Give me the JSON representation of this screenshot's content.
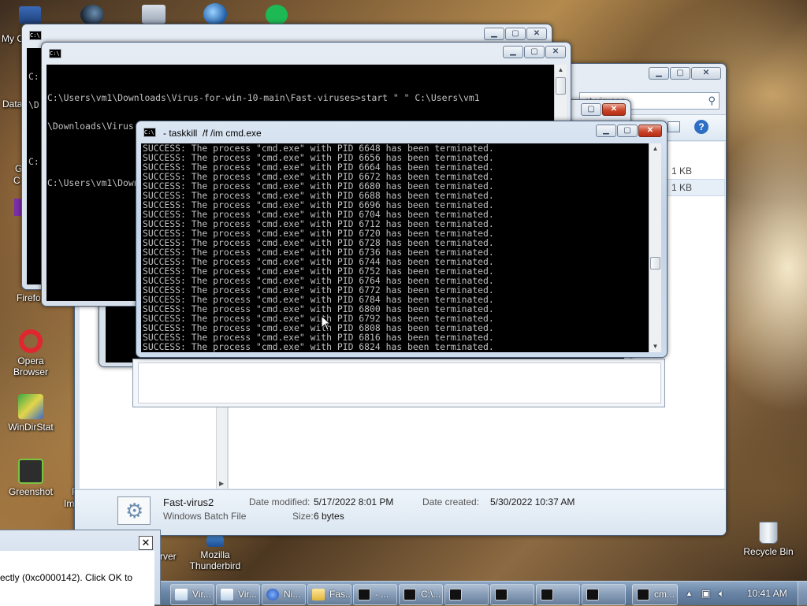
{
  "desktop": {
    "icons": [
      {
        "label": "Opera\nBrowser",
        "icon": "opera-icon"
      },
      {
        "label": "WinDirStat",
        "icon": "windirstat-icon"
      },
      {
        "label": "Greenshot",
        "icon": "greenshot-icon"
      },
      {
        "label": "Mozilla\nThunderbird",
        "icon": "thunderbird-icon"
      },
      {
        "label": "Recycle Bin",
        "icon": "recycle-bin-icon"
      }
    ],
    "partial_labels": [
      "My C",
      "Data",
      "G",
      "C",
      "Firefo",
      "F",
      "Image V",
      "rver"
    ]
  },
  "cmd_window_back": {
    "title": "",
    "lines": [
      "C:",
      "\\D",
      "",
      "C:"
    ]
  },
  "cmd_window_middle": {
    "title": "",
    "lines": [
      "C:\\Users\\vm1\\Downloads\\Virus-for-win-10-main\\Fast-viruses>start \" \" C:\\Users\\vm1",
      "\\Downloads\\Virus-for-win-10-main\\Fast-viruses\\Fast-virus1.bat",
      "",
      "C:\\Users\\vm1\\Downloads\\Virus-for-win-10-main\\Fast-viruses>"
    ]
  },
  "taskkill_window": {
    "title": "- taskkill  /f /im cmd.exe",
    "lines": [
      "SUCCESS: The process \"cmd.exe\" with PID 6648 has been terminated.",
      "SUCCESS: The process \"cmd.exe\" with PID 6656 has been terminated.",
      "SUCCESS: The process \"cmd.exe\" with PID 6664 has been terminated.",
      "SUCCESS: The process \"cmd.exe\" with PID 6672 has been terminated.",
      "SUCCESS: The process \"cmd.exe\" with PID 6680 has been terminated.",
      "SUCCESS: The process \"cmd.exe\" with PID 6688 has been terminated.",
      "SUCCESS: The process \"cmd.exe\" with PID 6696 has been terminated.",
      "SUCCESS: The process \"cmd.exe\" with PID 6704 has been terminated.",
      "SUCCESS: The process \"cmd.exe\" with PID 6712 has been terminated.",
      "SUCCESS: The process \"cmd.exe\" with PID 6720 has been terminated.",
      "SUCCESS: The process \"cmd.exe\" with PID 6728 has been terminated.",
      "SUCCESS: The process \"cmd.exe\" with PID 6736 has been terminated.",
      "SUCCESS: The process \"cmd.exe\" with PID 6744 has been terminated.",
      "SUCCESS: The process \"cmd.exe\" with PID 6752 has been terminated.",
      "SUCCESS: The process \"cmd.exe\" with PID 6764 has been terminated.",
      "SUCCESS: The process \"cmd.exe\" with PID 6772 has been terminated.",
      "SUCCESS: The process \"cmd.exe\" with PID 6784 has been terminated.",
      "SUCCESS: The process \"cmd.exe\" with PID 6800 has been terminated.",
      "SUCCESS: The process \"cmd.exe\" with PID 6792 has been terminated.",
      "SUCCESS: The process \"cmd.exe\" with PID 6808 has been terminated.",
      "SUCCESS: The process \"cmd.exe\" with PID 6816 has been terminated.",
      "SUCCESS: The process \"cmd.exe\" with PID 6824 has been terminated."
    ]
  },
  "explorer": {
    "address_partial": "st-viruses",
    "sizes": [
      "1 KB",
      "1 KB"
    ],
    "details": {
      "name": "Fast-virus2",
      "type": "Windows Batch File",
      "modified_label": "Date modified:",
      "modified_value": "5/17/2022 8:01 PM",
      "size_label": "Size:",
      "size_value": "6 bytes",
      "created_label": "Date created:",
      "created_value": "5/30/2022 10:37 AM"
    }
  },
  "error_dialog": {
    "message": "ectly (0xc0000142). Click OK to",
    "close": "✕"
  },
  "taskbar": {
    "buttons": [
      {
        "label": "Vir...",
        "icon": "notepad-icon"
      },
      {
        "label": "Vir...",
        "icon": "notepad-icon"
      },
      {
        "label": "Ni...",
        "icon": "browser-icon"
      },
      {
        "label": "Fas...",
        "icon": "folder-icon"
      },
      {
        "label": "- ...",
        "icon": "cmd-icon"
      },
      {
        "label": "C:\\...",
        "icon": "cmd-icon"
      },
      {
        "label": "",
        "icon": "cmd-icon"
      },
      {
        "label": "",
        "icon": "cmd-icon"
      },
      {
        "label": "",
        "icon": "cmd-icon"
      },
      {
        "label": "",
        "icon": "cmd-icon"
      },
      {
        "label": "cm...",
        "icon": "cmd-icon"
      }
    ],
    "clock": "10:41 AM",
    "tray_icons": [
      "show-hidden-icon",
      "network-icon",
      "volume-icon"
    ]
  },
  "colors": {
    "console_bg": "#000000",
    "console_text": "#c0c0c0",
    "close_button": "#c9452a"
  }
}
